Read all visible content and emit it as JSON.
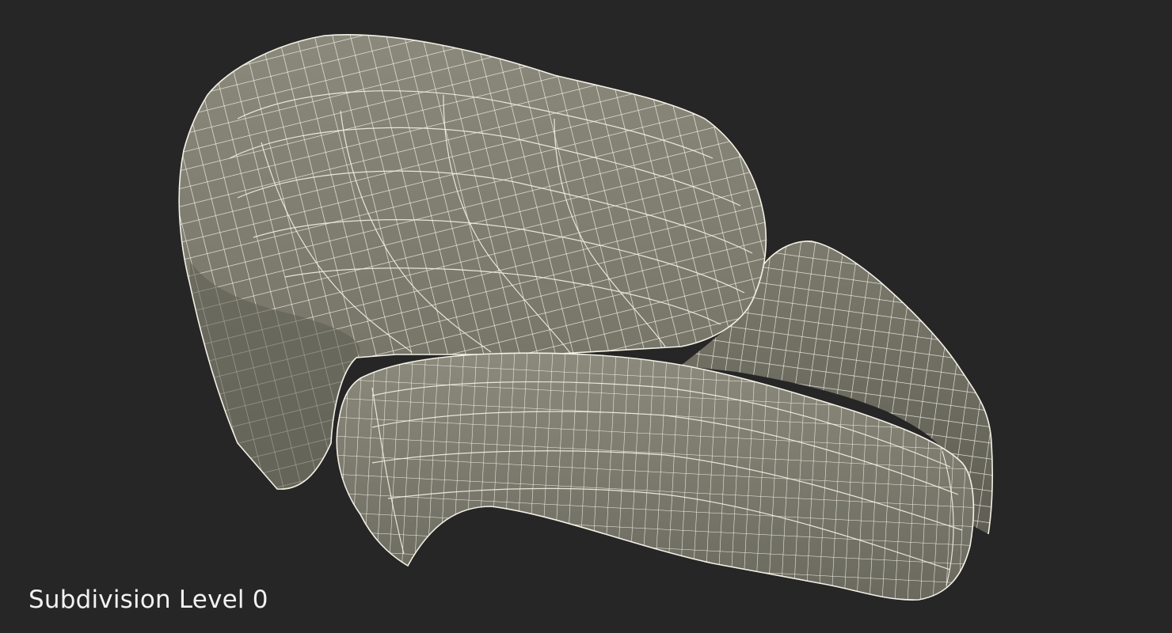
{
  "caption": {
    "text": "Subdivision Level 0"
  },
  "render": {
    "background_color": "#262626",
    "mesh_fill_color": "#7b7a6c",
    "mesh_shadow_color": "#5d5d52",
    "wire_color": "#f4f1e6",
    "subject": "wireframe-mesh-model"
  }
}
